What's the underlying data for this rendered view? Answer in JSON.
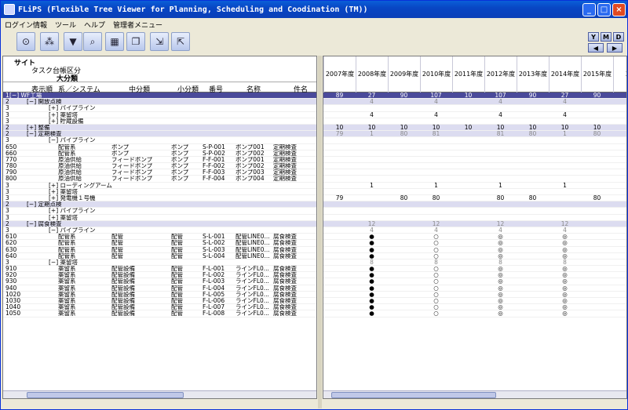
{
  "title": "FLiPS (Flexible Tree Viewer for Planning, Scheduling and Coodination (TM))",
  "window_buttons": {
    "min": "_",
    "max": "□",
    "close": "×"
  },
  "menu": [
    "ログイン情報",
    "ツール",
    "ヘルプ",
    "管理者メニュー"
  ],
  "toolbar_icons": [
    "binoculars-icon",
    "network-icon",
    "filter-icon",
    "magnifier-icon",
    "grid-icon",
    "copy-icon",
    "export-icon",
    "import-icon"
  ],
  "mode_buttons": [
    "Y",
    "M",
    "D"
  ],
  "nav": {
    "prev": "◀",
    "next": "▶"
  },
  "left_header": {
    "site": "サイト",
    "task": "タスク台帳区分",
    "major": "大分類",
    "col_order": "表示順",
    "col_system": "系／システム",
    "col_mid": "中分類",
    "col_minor": "小分類",
    "col_no": "番号",
    "col_name": "名称",
    "col_item": "件名"
  },
  "years": [
    "2007年度",
    "2008年度",
    "2009年度",
    "2010年度",
    "2011年度",
    "2012年度",
    "2013年度",
    "2014年度",
    "2015年度",
    "20"
  ],
  "rows": [
    {
      "lv": "1",
      "t": "l1",
      "tree": "[−]  WF工場",
      "vals": [
        "89",
        "27",
        "90",
        "107",
        "10",
        "107",
        "90",
        "27",
        "90"
      ]
    },
    {
      "lv": "2",
      "t": "l2",
      "tree": "[−]  開放点検",
      "vals": [
        "",
        "4",
        "",
        "4",
        "",
        "4",
        "",
        "4",
        ""
      ],
      "dim": true
    },
    {
      "lv": "3",
      "t": "l3",
      "tree": "[+]  パイプライン",
      "vals": [
        "",
        "",
        "",
        "",
        "",
        "",
        "",
        "",
        ""
      ]
    },
    {
      "lv": "3",
      "t": "l3",
      "tree": "[+]  薬留塔",
      "vals": [
        "",
        "4",
        "",
        "4",
        "",
        "4",
        "",
        "4",
        ""
      ]
    },
    {
      "lv": "3",
      "t": "l3",
      "tree": "[+]  貯蔵設備",
      "vals": [
        "",
        "",
        "",
        "",
        "",
        "",
        "",
        "",
        ""
      ]
    },
    {
      "lv": "2",
      "t": "l2",
      "tree": "[+]  整備",
      "vals": [
        "10",
        "10",
        "10",
        "10",
        "10",
        "10",
        "10",
        "10",
        "10"
      ]
    },
    {
      "lv": "2",
      "t": "l2",
      "tree": "[−]  定期検査",
      "vals": [
        "79",
        "1",
        "80",
        "81",
        "",
        "81",
        "80",
        "1",
        "80"
      ],
      "dim": true
    },
    {
      "lv": "3",
      "t": "l3",
      "tree": "[−]  パイプライン",
      "vals": [
        "",
        "",
        "",
        "",
        "",
        "",
        "",
        "",
        ""
      ]
    },
    {
      "lv": "650",
      "t": "d",
      "sys": "配管系",
      "mid": "ポンプ",
      "minor": "ポンプ",
      "no": "S-P-001",
      "name": "ポンプ001",
      "item": "定期検査",
      "vals": [
        "",
        "",
        "",
        "",
        "",
        "",
        "",
        "",
        ""
      ]
    },
    {
      "lv": "660",
      "t": "d",
      "sys": "配管系",
      "mid": "ポンプ",
      "minor": "ポンプ",
      "no": "S-P-002",
      "name": "ポンプ002",
      "item": "定期検査",
      "vals": [
        "",
        "",
        "",
        "",
        "",
        "",
        "",
        "",
        ""
      ]
    },
    {
      "lv": "770",
      "t": "d",
      "sys": "原油供給",
      "mid": "フィードポンプ",
      "minor": "ポンプ",
      "no": "F-F-001",
      "name": "ポンプ001",
      "item": "定期検査",
      "vals": [
        "",
        "",
        "",
        "",
        "",
        "",
        "",
        "",
        ""
      ]
    },
    {
      "lv": "780",
      "t": "d",
      "sys": "原油供給",
      "mid": "フィードポンプ",
      "minor": "ポンプ",
      "no": "F-F-002",
      "name": "ポンプ002",
      "item": "定期検査",
      "vals": [
        "",
        "",
        "",
        "",
        "",
        "",
        "",
        "",
        ""
      ]
    },
    {
      "lv": "790",
      "t": "d",
      "sys": "原油供給",
      "mid": "フィードポンプ",
      "minor": "ポンプ",
      "no": "F-F-003",
      "name": "ポンプ003",
      "item": "定期検査",
      "vals": [
        "",
        "",
        "",
        "",
        "",
        "",
        "",
        "",
        ""
      ]
    },
    {
      "lv": "800",
      "t": "d",
      "sys": "原油供給",
      "mid": "フィードポンプ",
      "minor": "ポンプ",
      "no": "F-F-004",
      "name": "ポンプ004",
      "item": "定期検査",
      "vals": [
        "",
        "",
        "",
        "",
        "",
        "",
        "",
        "",
        ""
      ]
    },
    {
      "lv": "3",
      "t": "l3",
      "tree": "[+]  ローディングアーム",
      "vals": [
        "",
        "1",
        "",
        "1",
        "",
        "1",
        "",
        "1",
        ""
      ]
    },
    {
      "lv": "3",
      "t": "l3",
      "tree": "[+]  薬留塔",
      "vals": [
        "",
        "",
        "",
        "",
        "",
        "",
        "",
        "",
        ""
      ]
    },
    {
      "lv": "3",
      "t": "l3",
      "tree": "[+]  発電機１号機",
      "vals": [
        "79",
        "",
        "80",
        "80",
        "",
        "80",
        "80",
        "",
        "80"
      ]
    },
    {
      "lv": "2",
      "t": "l2",
      "tree": "[−]  定期点検",
      "vals": [
        "",
        "",
        "",
        "",
        "",
        "",
        "",
        "",
        ""
      ]
    },
    {
      "lv": "3",
      "t": "l3",
      "tree": "[+]  パイプライン",
      "vals": [
        "",
        "",
        "",
        "",
        "",
        "",
        "",
        "",
        ""
      ]
    },
    {
      "lv": "3",
      "t": "l3",
      "tree": "[+]  薬留塔",
      "vals": [
        "",
        "",
        "",
        "",
        "",
        "",
        "",
        "",
        ""
      ]
    },
    {
      "lv": "2",
      "t": "l2",
      "tree": "[−]  腐食検査",
      "vals": [
        "",
        "12",
        "",
        "12",
        "",
        "12",
        "",
        "12",
        ""
      ],
      "dim": true
    },
    {
      "lv": "3",
      "t": "l3",
      "tree": "[−]  パイプライン",
      "vals": [
        "",
        "4",
        "",
        "4",
        "",
        "4",
        "",
        "4",
        ""
      ],
      "dim": true
    },
    {
      "lv": "610",
      "t": "d",
      "sys": "配管系",
      "mid": "配管",
      "minor": "配管",
      "no": "S-L-001",
      "name": "配管LINE0...",
      "item": "腐食検査",
      "vals": [
        "",
        "●",
        "",
        "○",
        "",
        "◎",
        "",
        "◎",
        ""
      ]
    },
    {
      "lv": "620",
      "t": "d",
      "sys": "配管系",
      "mid": "配管",
      "minor": "配管",
      "no": "S-L-002",
      "name": "配管LINE0...",
      "item": "腐食検査",
      "vals": [
        "",
        "●",
        "",
        "○",
        "",
        "◎",
        "",
        "◎",
        ""
      ]
    },
    {
      "lv": "630",
      "t": "d",
      "sys": "配管系",
      "mid": "配管",
      "minor": "配管",
      "no": "S-L-003",
      "name": "配管LINE0...",
      "item": "腐食検査",
      "vals": [
        "",
        "●",
        "",
        "○",
        "",
        "◎",
        "",
        "◎",
        ""
      ]
    },
    {
      "lv": "640",
      "t": "d",
      "sys": "配管系",
      "mid": "配管",
      "minor": "配管",
      "no": "S-L-004",
      "name": "配管LINE0...",
      "item": "腐食検査",
      "vals": [
        "",
        "●",
        "",
        "○",
        "",
        "◎",
        "",
        "◎",
        ""
      ]
    },
    {
      "lv": "3",
      "t": "l3",
      "tree": "[−]  薬留塔",
      "vals": [
        "",
        "8",
        "",
        "8",
        "",
        "8",
        "",
        "8",
        ""
      ],
      "dim": true
    },
    {
      "lv": "910",
      "t": "d",
      "sys": "薬留系",
      "mid": "配管設備",
      "minor": "配管",
      "no": "F-L-001",
      "name": "ラインFL0...",
      "item": "腐食検査",
      "vals": [
        "",
        "●",
        "",
        "○",
        "",
        "◎",
        "",
        "◎",
        ""
      ]
    },
    {
      "lv": "920",
      "t": "d",
      "sys": "薬留系",
      "mid": "配管設備",
      "minor": "配管",
      "no": "F-L-002",
      "name": "ラインFL0...",
      "item": "腐食検査",
      "vals": [
        "",
        "●",
        "",
        "○",
        "",
        "◎",
        "",
        "◎",
        ""
      ]
    },
    {
      "lv": "930",
      "t": "d",
      "sys": "薬留系",
      "mid": "配管設備",
      "minor": "配管",
      "no": "F-L-003",
      "name": "ラインFL0...",
      "item": "腐食検査",
      "vals": [
        "",
        "●",
        "",
        "○",
        "",
        "◎",
        "",
        "◎",
        ""
      ]
    },
    {
      "lv": "940",
      "t": "d",
      "sys": "薬留系",
      "mid": "配管設備",
      "minor": "配管",
      "no": "F-L-004",
      "name": "ラインFL0...",
      "item": "腐食検査",
      "vals": [
        "",
        "●",
        "",
        "○",
        "",
        "◎",
        "",
        "◎",
        ""
      ]
    },
    {
      "lv": "1020",
      "t": "d",
      "sys": "薬留系",
      "mid": "配管設備",
      "minor": "配管",
      "no": "F-L-005",
      "name": "ラインFL0...",
      "item": "腐食検査",
      "vals": [
        "",
        "●",
        "",
        "○",
        "",
        "◎",
        "",
        "◎",
        ""
      ]
    },
    {
      "lv": "1030",
      "t": "d",
      "sys": "薬留系",
      "mid": "配管設備",
      "minor": "配管",
      "no": "F-L-006",
      "name": "ラインFL0...",
      "item": "腐食検査",
      "vals": [
        "",
        "●",
        "",
        "○",
        "",
        "◎",
        "",
        "◎",
        ""
      ]
    },
    {
      "lv": "1040",
      "t": "d",
      "sys": "薬留系",
      "mid": "配管設備",
      "minor": "配管",
      "no": "F-L-007",
      "name": "ラインFL0...",
      "item": "腐食検査",
      "vals": [
        "",
        "●",
        "",
        "○",
        "",
        "◎",
        "",
        "◎",
        ""
      ]
    },
    {
      "lv": "1050",
      "t": "d",
      "sys": "薬留系",
      "mid": "配管設備",
      "minor": "配管",
      "no": "F-L-008",
      "name": "ラインFL0...",
      "item": "腐食検査",
      "vals": [
        "",
        "●",
        "",
        "○",
        "",
        "◎",
        "",
        "◎",
        ""
      ]
    }
  ]
}
